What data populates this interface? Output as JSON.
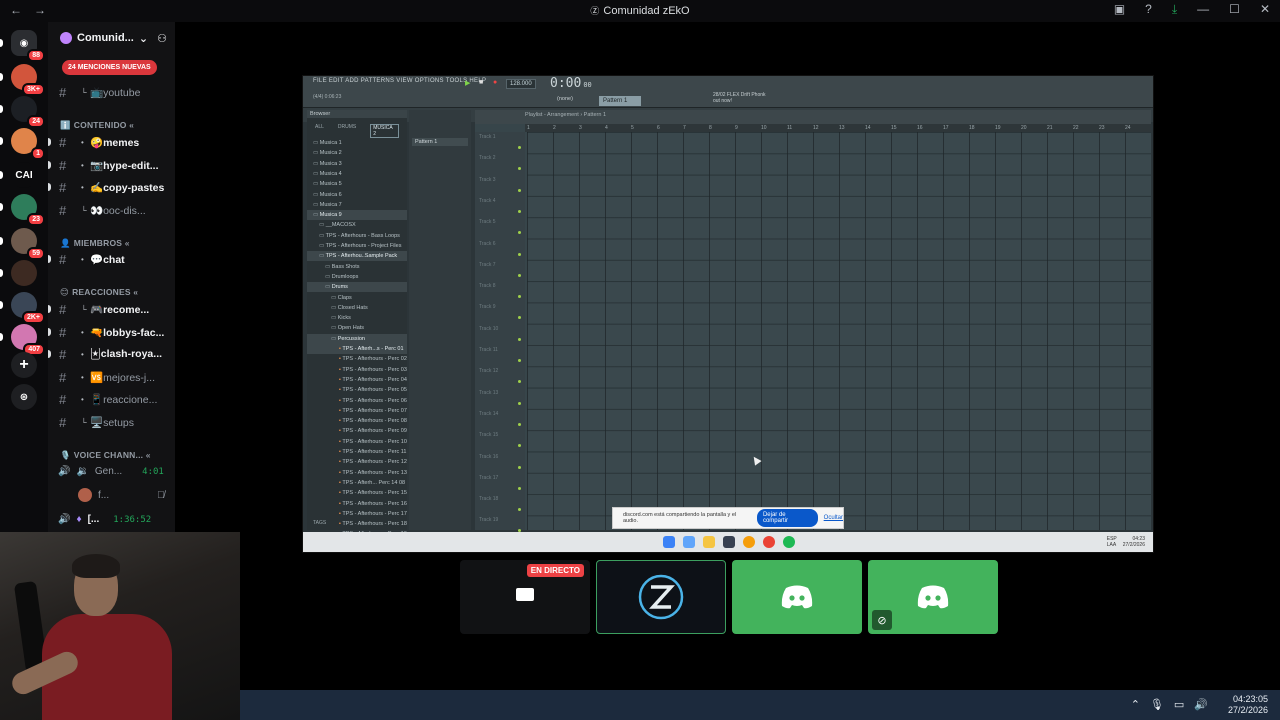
{
  "window": {
    "title": "Comunidad zEkO",
    "nav_back": "←",
    "nav_forward": "→"
  },
  "guilds": [
    {
      "name": "discord-home-icon",
      "badge": "88",
      "color": "#2b2d31"
    },
    {
      "name": "guild-1",
      "badge": "3K+",
      "color": "#d2553c"
    },
    {
      "name": "guild-zeko",
      "badge": "24",
      "color": "#1c1f24"
    },
    {
      "name": "guild-3",
      "badge": "1",
      "color": "#e0844a"
    },
    {
      "name": "guild-cai",
      "badge": "",
      "color": "#0b0b0d",
      "label": "CAI"
    },
    {
      "name": "guild-5",
      "badge": "23",
      "color": "#2e7d5b"
    },
    {
      "name": "guild-6",
      "badge": "59",
      "color": "#6e5a4d"
    },
    {
      "name": "guild-7",
      "badge": "",
      "color": "#3d2a22"
    },
    {
      "name": "guild-8",
      "badge": "2K+",
      "color": "#3a4656"
    },
    {
      "name": "guild-9",
      "badge": "407",
      "color": "#d277b1"
    }
  ],
  "server": {
    "name": "Comunid...",
    "mentions": "24 MENCIONES NUEVAS"
  },
  "channels": [
    {
      "label": "youtube",
      "prefix": "📺",
      "unread": false,
      "sub": true
    },
    {
      "category": "CONTENIDO",
      "emoji": "ℹ️"
    },
    {
      "label": "memes",
      "prefix": "🤪",
      "unread": true
    },
    {
      "label": "hype-edit...",
      "prefix": "📷",
      "unread": true
    },
    {
      "label": "copy-pastes",
      "prefix": "✍️",
      "unread": true
    },
    {
      "label": "ooc-dis...",
      "prefix": "👀",
      "unread": false,
      "sub": true
    },
    {
      "category": "MIEMBROS",
      "emoji": "👤"
    },
    {
      "label": "chat",
      "prefix": "💬",
      "unread": true
    },
    {
      "category": "REACCIONES",
      "emoji": "😊"
    },
    {
      "label": "recome...",
      "prefix": "🎮",
      "unread": true,
      "sub": true
    },
    {
      "label": "lobbys-fac...",
      "prefix": "🔫",
      "unread": true
    },
    {
      "label": "clash-roya...",
      "prefix": "🃏",
      "unread": true
    },
    {
      "label": "mejores-j...",
      "prefix": "🆚",
      "unread": false
    },
    {
      "label": "reaccione...",
      "prefix": "📱",
      "unread": false
    },
    {
      "label": "setups",
      "prefix": "🖥️",
      "unread": false,
      "sub": true
    },
    {
      "category": "VOICE CHANN...",
      "emoji": "🎙️"
    }
  ],
  "voice": {
    "channel_label": "Gen...",
    "channel_time": "4:01",
    "user_label": "f...",
    "stream_label": "[...",
    "stream_time": "1:36:52"
  },
  "fl": {
    "menu": "FILE EDIT ADD PATTERNS VIEW OPTIONS TOOLS HELP",
    "sub_line1": "(4/4) 0:06:23",
    "tempo": "128.000",
    "time": "0:00",
    "time_small": "00",
    "pattern": "Pattern 1",
    "none": "(none)",
    "news_line1": "28/02 FLEX Drift Phonk",
    "news_line2": "out now!",
    "browser_title": "Browser",
    "browser_tabs": [
      "ALL",
      "DRUMS",
      "MUSICA 2"
    ],
    "browser_items": [
      "Musica 1",
      "Musica 2",
      "Musica 3",
      "Musica 4",
      "Musica 5",
      "Musica 6",
      "Musica 7",
      "Musica 9",
      "__MACOSX",
      "TPS - Afterhours - Bass Loops",
      "TPS - Afterhours - Project Files",
      "TPS - Afterhou..Sample Pack",
      "Bass Shots",
      "Drumloops",
      "Drums",
      "Claps",
      "Closed Hats",
      "Kicks",
      "Open Hats",
      "Percussion",
      "TPS - Afterh...s - Perc 01",
      "TPS - Afterhours - Perc 02",
      "TPS - Afterhours - Perc 03",
      "TPS - Afterhours - Perc 04",
      "TPS - Afterhours - Perc 05",
      "TPS - Afterhours - Perc 06",
      "TPS - Afterhours - Perc 07",
      "TPS - Afterhours - Perc 08",
      "TPS - Afterhours - Perc 09",
      "TPS - Afterhours - Perc 10",
      "TPS - Afterhours - Perc 11",
      "TPS - Afterhours - Perc 12",
      "TPS - Afterhours - Perc 13",
      "TPS - Afterh... Perc 14 08",
      "TPS - Afterhours - Perc 15",
      "TPS - Afterhours - Perc 16",
      "TPS - Afterhours - Perc 17",
      "TPS - Afterhours - Perc 18",
      "TPS - Afterhours - Perc 19"
    ],
    "channel_pattern": "Pattern 1",
    "playlist_header": "Playlist - Arrangement › Pattern 1",
    "tracks": [
      "Track 1",
      "Track 2",
      "Track 3",
      "Track 4",
      "Track 5",
      "Track 6",
      "Track 7",
      "Track 8",
      "Track 9",
      "Track 10",
      "Track 11",
      "Track 12",
      "Track 13",
      "Track 14",
      "Track 15",
      "Track 16",
      "Track 17",
      "Track 18",
      "Track 19"
    ],
    "bars": [
      "1",
      "2",
      "3",
      "4",
      "5",
      "6",
      "7",
      "8",
      "9",
      "10",
      "11",
      "12",
      "13",
      "14",
      "15",
      "16",
      "17",
      "18",
      "19",
      "20",
      "21",
      "22",
      "23",
      "24"
    ],
    "tags": "TAGS",
    "tray_lang1": "ESP",
    "tray_lang2": "LAA",
    "tray_time": "04:23",
    "tray_date": "27/2/2026"
  },
  "share_bar": {
    "text": "discord.com está compartiendo la pantalla y el audio.",
    "stop": "Dejar de compartir",
    "hide": "Ocultar"
  },
  "tiles": {
    "live": "EN DIRECTO"
  },
  "taskbar": {
    "time": "04:23:05",
    "date": "27/2/2026"
  },
  "colors": {
    "discord_green": "#43b35c",
    "badge_red": "#f23f43",
    "fl_bg": "#2c3539"
  }
}
